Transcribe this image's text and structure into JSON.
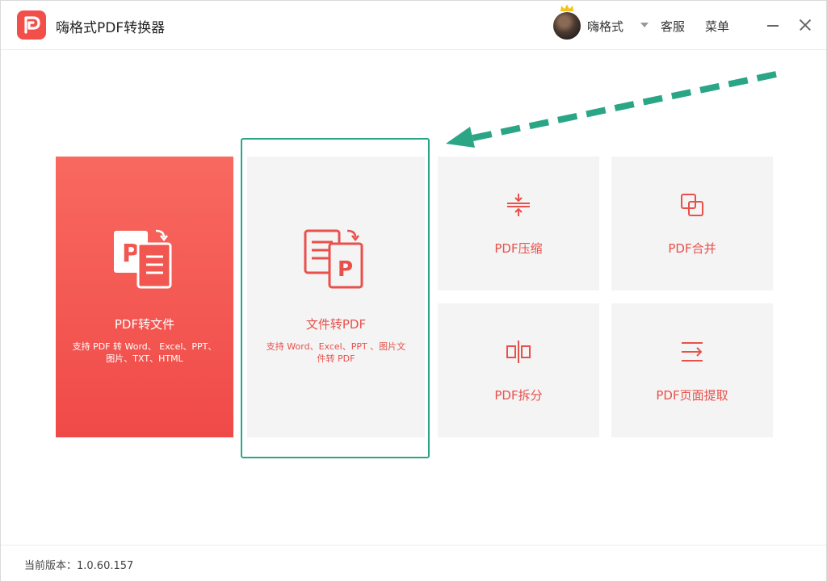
{
  "header": {
    "app_title": "嗨格式PDF转换器",
    "username": "嗨格式",
    "service_label": "客服",
    "menu_label": "菜单"
  },
  "cards": {
    "pdf_to_file": {
      "title": "PDF转文件",
      "desc": "支持 PDF 转 Word、 Excel、PPT、图片、TXT、HTML"
    },
    "file_to_pdf": {
      "title": "文件转PDF",
      "desc": "支持 Word、Excel、PPT 、图片文件转 PDF"
    },
    "compress": {
      "title": "PDF压缩"
    },
    "merge": {
      "title": "PDF合并"
    },
    "split": {
      "title": "PDF拆分"
    },
    "extract": {
      "title": "PDF页面提取"
    }
  },
  "footer": {
    "version_label": "当前版本：1.0.60.157"
  },
  "colors": {
    "brand_red": "#f04a48",
    "accent_text": "#e8504b",
    "card_bg": "#f4f4f4",
    "annotation_green": "#2aa686"
  },
  "icons": {
    "logo": "pdf-logo-icon",
    "crown": "crown-icon",
    "compress": "compress-icon",
    "merge": "merge-icon",
    "split": "split-icon",
    "extract": "extract-icon"
  }
}
